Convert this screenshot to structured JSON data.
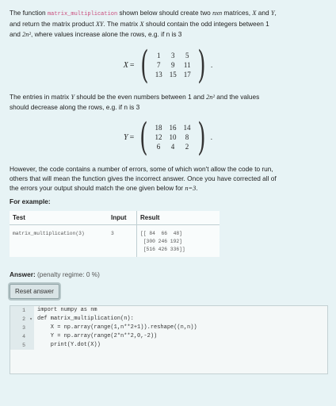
{
  "intro": {
    "t1": "The function ",
    "func": "matrix_multiplication",
    "t2": " shown below should create two ",
    "nxn": "nxn",
    "t3": " matrices, ",
    "X": "X",
    "t4": " and ",
    "Y": "Y",
    "t5": ",",
    "line2a": "and return the matrix product ",
    "XY": "XY",
    "line2b": ". The matrix ",
    "line2c": " should contain the odd integers between 1",
    "line3a": "and ",
    "twon2": "2n²",
    "line3b": ", where values increase alone the rows, e.g. if n is 3"
  },
  "matrixX": {
    "name": "X",
    "eq": "=",
    "cells": [
      "1",
      "3",
      "5",
      "7",
      "9",
      "11",
      "13",
      "15",
      "17"
    ],
    "tail": "."
  },
  "para2": {
    "l1a": "The entries in matrix ",
    "l1b": " should be the even numbers between 1 and ",
    "l1c": " and the values",
    "l2": "should decrease along the rows, e.g. if n is 3"
  },
  "matrixY": {
    "name": "Y",
    "eq": "=",
    "cells": [
      "18",
      "16",
      "14",
      "12",
      "10",
      "8",
      "6",
      "4",
      "2"
    ],
    "tail": "."
  },
  "para3": {
    "l1": "However, the code contains a number of errors, some of which won't allow the code to run,",
    "l2": "others that will mean the function gives the incorrect answer. Once you have corrected all of",
    "l3a": "the errors your output should match the one given below for ",
    "l3b": "n=3",
    "l3c": "."
  },
  "example": {
    "label": "For example:",
    "headers": {
      "test": "Test",
      "input": "Input",
      "result": "Result"
    },
    "test": "matrix_multiplication(3)",
    "input": "3",
    "result": [
      "[[ 84  66  48]",
      " [300 246 192]",
      " [516 426 336]]"
    ]
  },
  "answer": {
    "label": "Answer:",
    "penalty": "(penalty regime: 0 %)",
    "reset": "Reset answer"
  },
  "editor": {
    "lines": [
      {
        "num": "1",
        "fold": "",
        "code": "import numpy as nm"
      },
      {
        "num": "2",
        "fold": "▾",
        "code": "def matrix_multiplication(n):"
      },
      {
        "num": "3",
        "fold": "",
        "code": "    X = np.array(range(1,n**2+1)).reshape((n,n))"
      },
      {
        "num": "4",
        "fold": "",
        "code": "    Y = np.array(range(2*n**2,0,-2))"
      },
      {
        "num": "5",
        "fold": "",
        "code": "    print(Y.dot(X))"
      }
    ]
  }
}
